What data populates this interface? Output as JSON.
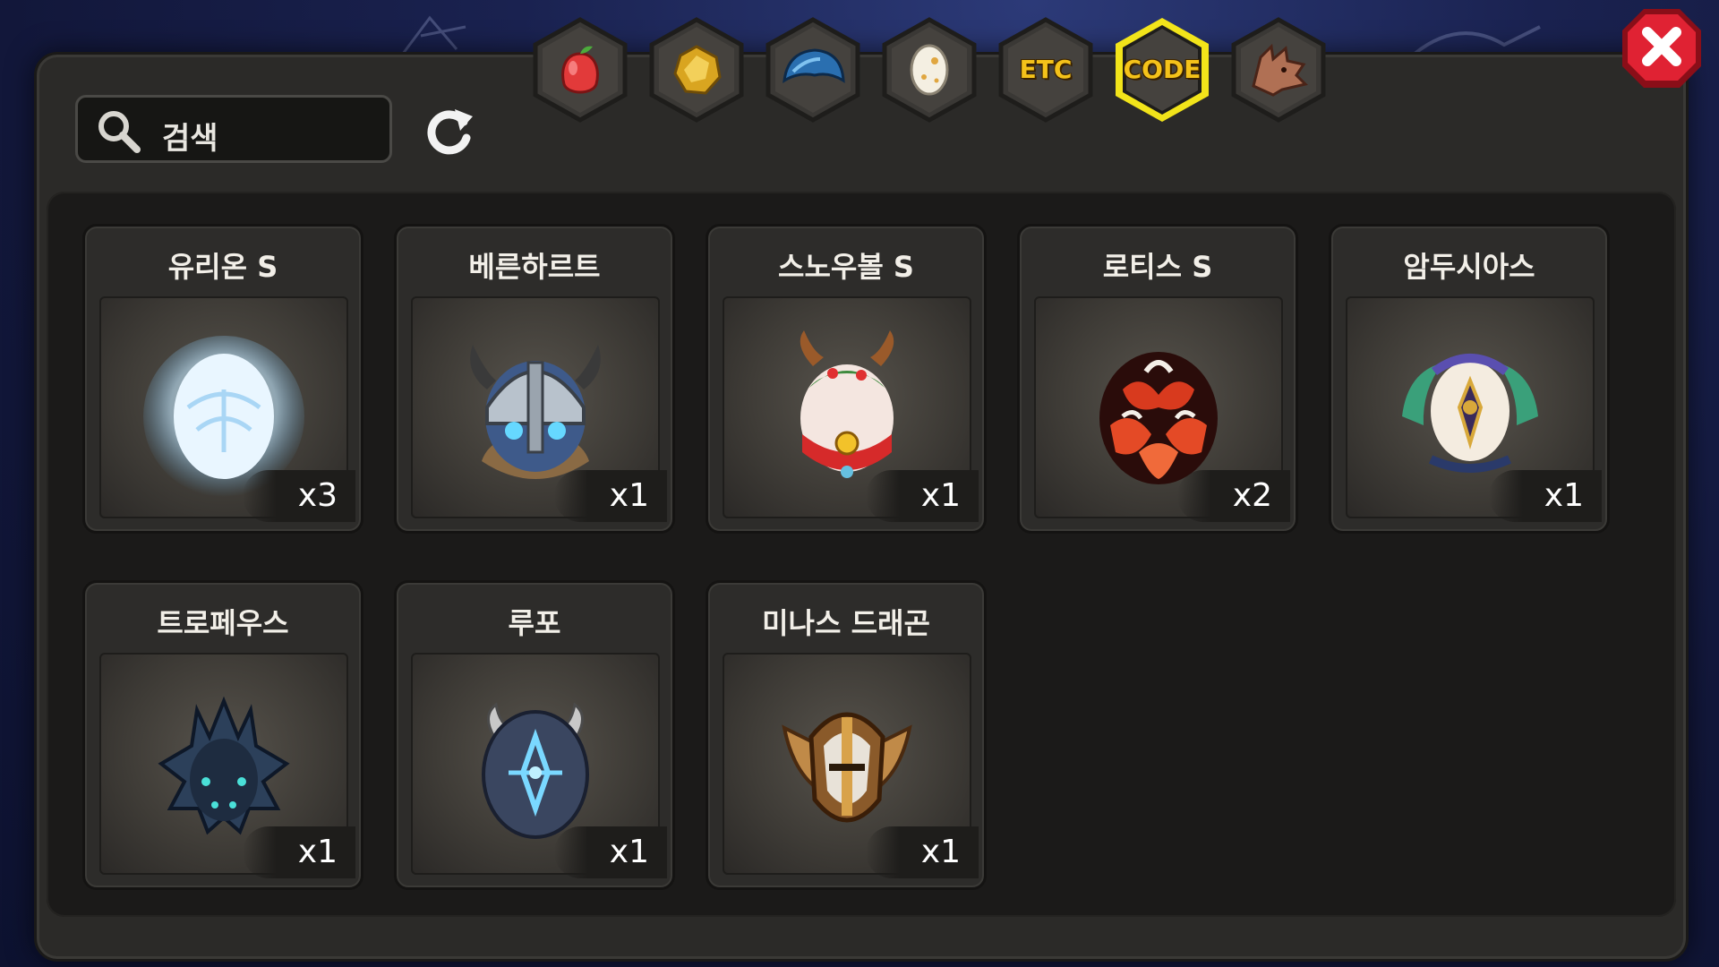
{
  "search": {
    "placeholder": "검색",
    "icon": "search-icon"
  },
  "tabs": [
    {
      "name": "fruit",
      "icon": "fruit-icon",
      "label": "",
      "selected": false
    },
    {
      "name": "gold",
      "icon": "gold-icon",
      "label": "",
      "selected": false
    },
    {
      "name": "scale",
      "icon": "scale-icon",
      "label": "",
      "selected": false
    },
    {
      "name": "egg",
      "icon": "egg-icon",
      "label": "",
      "selected": false
    },
    {
      "name": "etc",
      "icon": "",
      "label": "ETC",
      "selected": false
    },
    {
      "name": "code",
      "icon": "",
      "label": "CODE",
      "selected": true
    },
    {
      "name": "dragon",
      "icon": "dragon-head-icon",
      "label": "",
      "selected": false
    }
  ],
  "items": [
    {
      "name": "유리온 S",
      "count": "x3",
      "icon": "glowing-white-egg-icon",
      "color": "#cfe9ff"
    },
    {
      "name": "베른하르트",
      "count": "x1",
      "icon": "viking-helmet-egg-icon",
      "color": "#8aa0b8"
    },
    {
      "name": "스노우볼 S",
      "count": "x1",
      "icon": "christmas-reindeer-egg-icon",
      "color": "#d93c3c"
    },
    {
      "name": "로티스 S",
      "count": "x2",
      "icon": "red-feathered-egg-icon",
      "color": "#c2331e"
    },
    {
      "name": "암두시아스",
      "count": "x1",
      "icon": "laurel-emblem-egg-icon",
      "color": "#5a4fb0"
    },
    {
      "name": "트로페우스",
      "count": "x1",
      "icon": "dark-spiked-egg-icon",
      "color": "#2f4a66"
    },
    {
      "name": "루포",
      "count": "x1",
      "icon": "horned-crystal-egg-icon",
      "color": "#3c4a66"
    },
    {
      "name": "미나스 드래곤",
      "count": "x1",
      "icon": "winged-knight-helmet-icon",
      "color": "#b07a3a"
    }
  ],
  "colors": {
    "panel": "#2b2a28",
    "tab_selected_border": "#f2e41a",
    "close_button": "#d61a2a",
    "tab_label": "#f4c21a"
  }
}
